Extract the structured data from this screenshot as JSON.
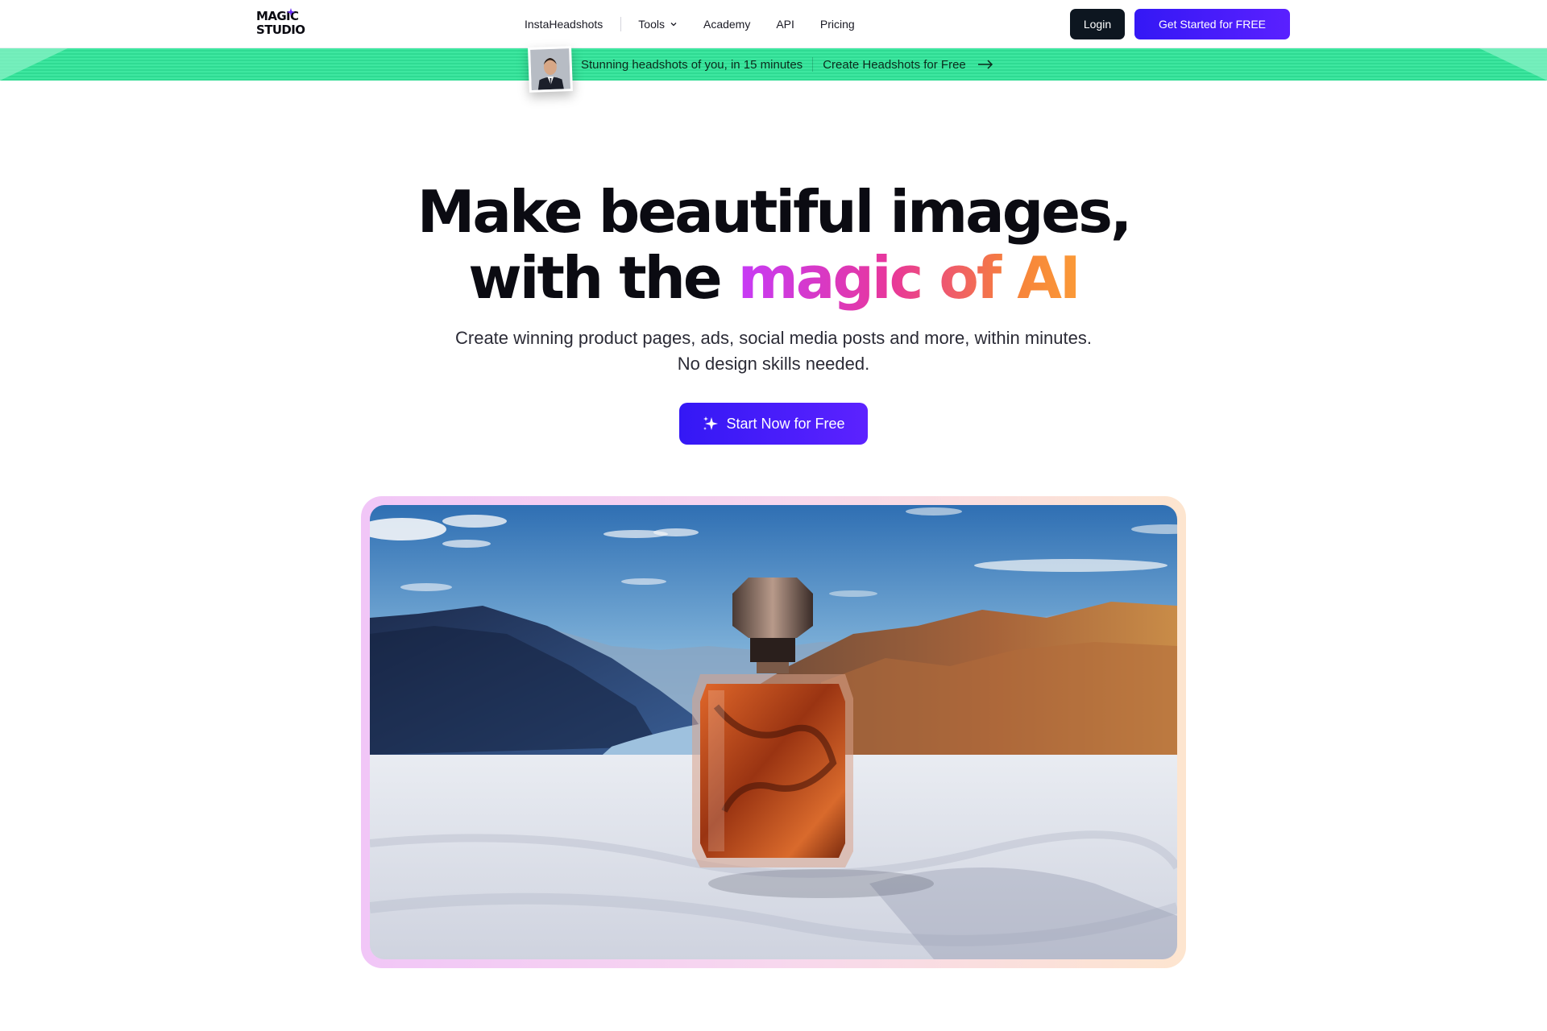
{
  "logo": {
    "line1": "MAGIC",
    "line2": "STUDIO"
  },
  "nav": {
    "items": [
      "InstaHeadshots",
      "Tools",
      "Academy",
      "API",
      "Pricing"
    ],
    "tools_icon": "chevron-down-icon"
  },
  "header": {
    "login_label": "Login",
    "get_started_label": "Get Started for FREE"
  },
  "banner": {
    "text": "Stunning headshots of you, in 15 minutes",
    "link_label": "Create Headshots for Free",
    "link_icon": "arrow-right-icon"
  },
  "hero": {
    "title_line1": "Make beautiful images,",
    "title_line2_plain": "with the ",
    "title_line2_gradient": "magic of AI",
    "subtitle_line1": "Create winning product pages, ads, social media posts and more, within minutes.",
    "subtitle_line2": "No design skills needed.",
    "cta_label": "Start Now for Free",
    "cta_icon": "sparkles-icon"
  },
  "colors": {
    "primary": "#3418f5",
    "dark": "#0d1620",
    "banner_green": "#3ee7a0"
  }
}
